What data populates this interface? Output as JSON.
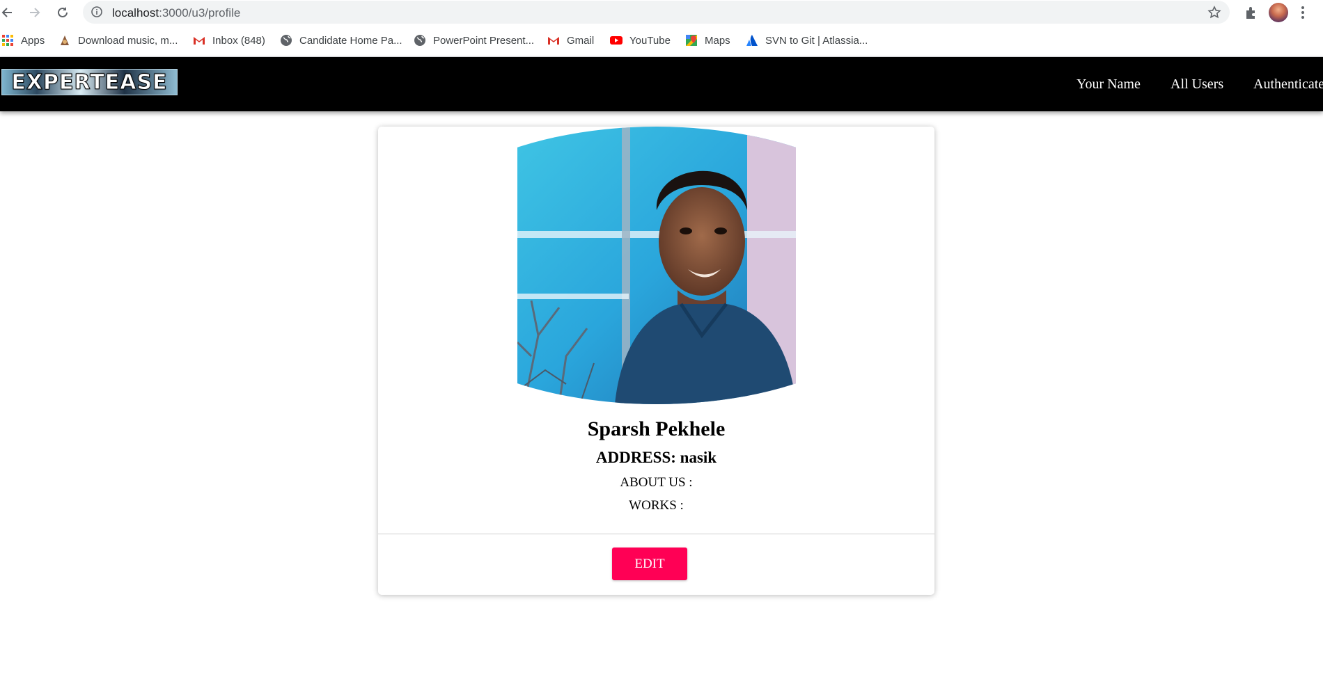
{
  "browser": {
    "url_host": "localhost",
    "url_rest": ":3000/u3/profile",
    "bookmarks": [
      {
        "label": "Apps",
        "icon": "apps-grid-icon"
      },
      {
        "label": "Download music, m...",
        "icon": "music-download-icon"
      },
      {
        "label": "Inbox (848)",
        "icon": "gmail-icon"
      },
      {
        "label": "Candidate Home Pa...",
        "icon": "globe-icon"
      },
      {
        "label": "PowerPoint Present...",
        "icon": "globe-icon"
      },
      {
        "label": "Gmail",
        "icon": "gmail-icon"
      },
      {
        "label": "YouTube",
        "icon": "youtube-icon"
      },
      {
        "label": "Maps",
        "icon": "maps-icon"
      },
      {
        "label": "SVN to Git | Atlassia...",
        "icon": "atlassian-icon"
      }
    ]
  },
  "app": {
    "logo_text": "EXPERTEASE",
    "nav": {
      "your_name": "Your Name",
      "all_users": "All Users",
      "authenticate": "Authenticate"
    }
  },
  "profile": {
    "name": "Sparsh Pekhele",
    "address": "ADDRESS: nasik",
    "about": "ABOUT US :",
    "works": "WORKS :",
    "edit_label": "EDIT"
  },
  "colors": {
    "navbar_bg": "#000000",
    "edit_button": "#ff0055"
  }
}
